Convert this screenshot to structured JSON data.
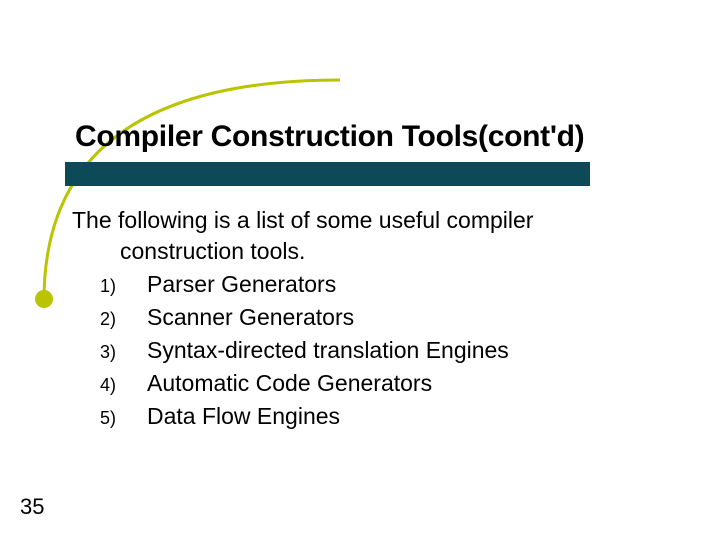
{
  "title": "Compiler Construction Tools(cont'd)",
  "intro_line1": "The following is a list of some useful compiler",
  "intro_line2": "construction tools.",
  "items": [
    {
      "num": "1)",
      "text": "Parser Generators"
    },
    {
      "num": "2)",
      "text": "Scanner Generators"
    },
    {
      "num": "3)",
      "text": "Syntax-directed translation Engines"
    },
    {
      "num": "4)",
      "text": "Automatic Code Generators"
    },
    {
      "num": "5)",
      "text": "Data Flow Engines"
    }
  ],
  "page_number": "35",
  "colors": {
    "underline": "#0b4a56",
    "accent_dot": "#b9c402"
  }
}
